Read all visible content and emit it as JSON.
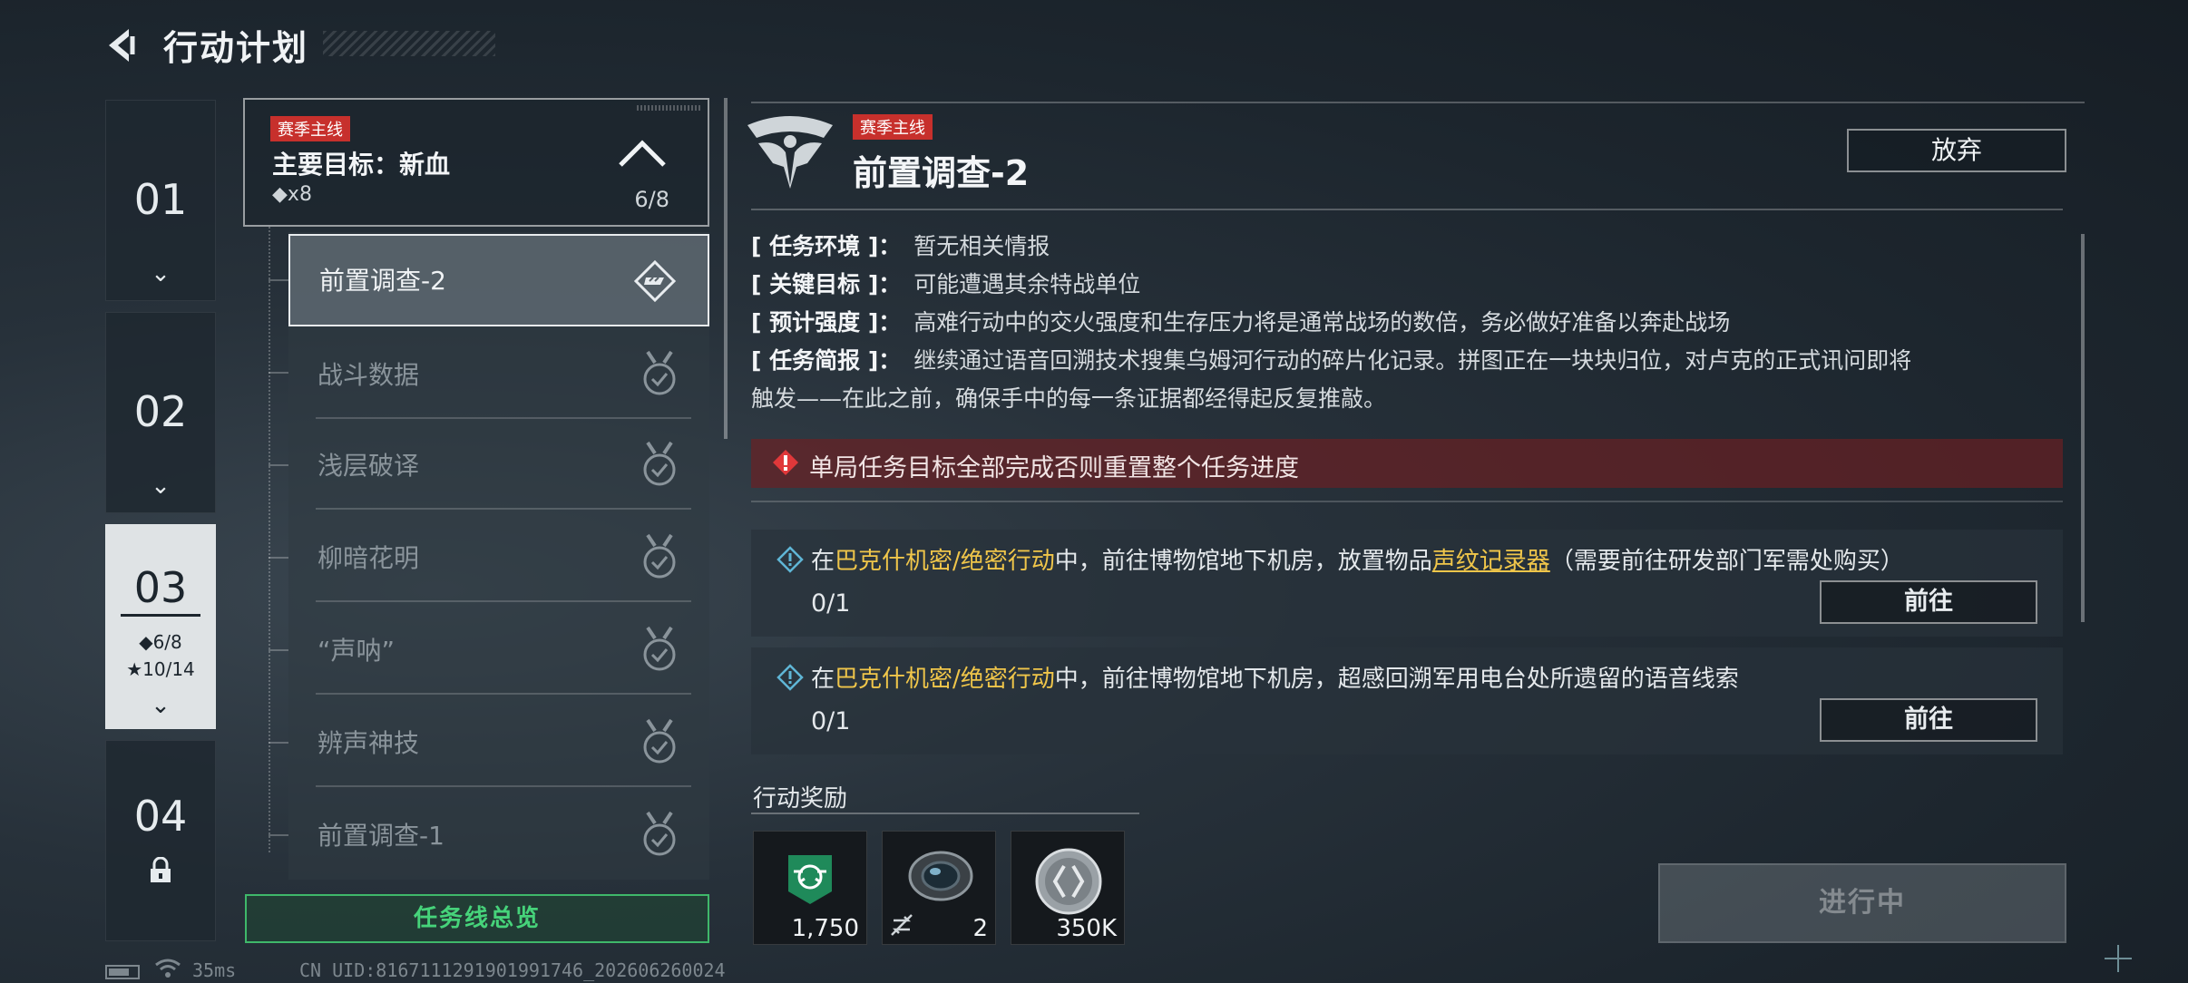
{
  "header": {
    "title": "行动计划"
  },
  "chapters": [
    {
      "num": "01",
      "chev": "⌄"
    },
    {
      "num": "02",
      "chev": "⌄"
    },
    {
      "num": "03",
      "chev": "⌄",
      "progress": "◆6/8",
      "stars": "★10/14"
    },
    {
      "num": "04"
    }
  ],
  "quest_header": {
    "tag": "赛季主线",
    "title": "主要目标：新血",
    "reward": "◆x8",
    "progress": "6/8"
  },
  "quests": [
    {
      "label": "前置调查-2"
    },
    {
      "label": "战斗数据"
    },
    {
      "label": "浅层破译"
    },
    {
      "label": "柳暗花明"
    },
    {
      "label": "“声呐”"
    },
    {
      "label": "辨声神技"
    },
    {
      "label": "前置调查-1"
    }
  ],
  "overview_button": "任务线总览",
  "detail": {
    "tag": "赛季主线",
    "title": "前置调查-2",
    "abandon": "放弃",
    "env_key": "[ 任务环境 ]：",
    "env_val": "暂无相关情报",
    "target_key": "[ 关键目标 ]：",
    "target_val": "可能遭遇其余特战单位",
    "strength_key": "[ 预计强度 ]：",
    "strength_val": "高难行动中的交火强度和生存压力将是通常战场的数倍，务必做好准备以奔赴战场",
    "brief_key": "[ 任务简报 ]：",
    "brief_val": "继续通过语音回溯技术搜集乌姆河行动的碎片化记录。拼图正在一块块归位，对卢克的正式讯问即将",
    "brief_val2": "触发——在此之前，确保手中的每一条证据都经得起反复推敲。",
    "warning": "单局任务目标全部完成否则重置整个任务进度"
  },
  "objectives": [
    {
      "pre": "在",
      "map": "巴克什机密/绝密行动",
      "mid": "中，前往博物馆地下机房，放置物品",
      "item": "声纹记录器",
      "post": "（需要前往研发部门军需处购买）",
      "progress": "0/1",
      "go": "前往"
    },
    {
      "pre": "在",
      "map": "巴克什机密/绝密行动",
      "mid": "中，前往博物馆地下机房，超感回溯军用电台处所遗留的语音线索",
      "item": "",
      "post": "",
      "progress": "0/1",
      "go": "前往"
    }
  ],
  "rewards": {
    "title": "行动奖励",
    "items": [
      {
        "icon": "drone-badge-icon",
        "count": "1,750"
      },
      {
        "icon": "scope-lens-icon",
        "count": "2"
      },
      {
        "icon": "coin-icon",
        "count": "350K"
      }
    ]
  },
  "status_button": "进行中",
  "footer": {
    "ping": "35ms",
    "uid": "CN UID:816711129190199174​6_202606260024"
  }
}
